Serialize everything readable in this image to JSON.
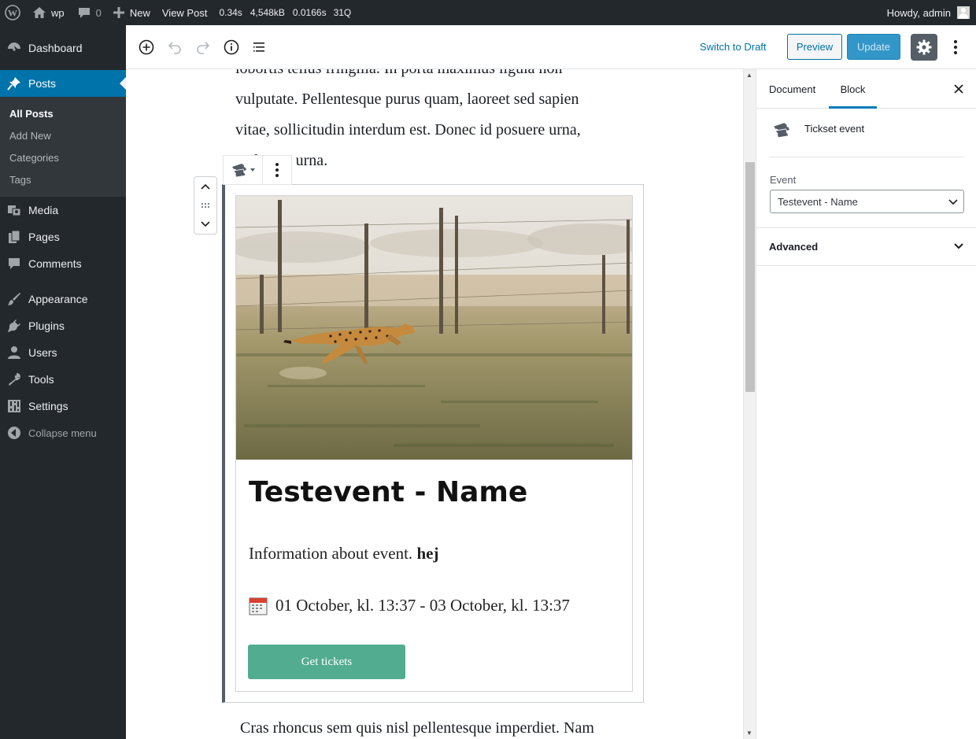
{
  "admin_bar": {
    "site_name": "wp",
    "comments_count": "0",
    "new_label": "New",
    "view_post_label": "View Post",
    "stats": [
      "0.34s",
      "4,548kB",
      "0.0166s",
      "31Q"
    ],
    "greeting": "Howdy, admin"
  },
  "menu": {
    "dashboard": "Dashboard",
    "posts": "Posts",
    "posts_submenu": [
      "All Posts",
      "Add New",
      "Categories",
      "Tags"
    ],
    "media": "Media",
    "pages": "Pages",
    "comments": "Comments",
    "appearance": "Appearance",
    "plugins": "Plugins",
    "users": "Users",
    "tools": "Tools",
    "settings": "Settings",
    "collapse": "Collapse menu"
  },
  "editor_header": {
    "switch_to_draft": "Switch to Draft",
    "preview": "Preview",
    "update": "Update"
  },
  "content": {
    "para_top": [
      "lobortis tellus fringilla. In porta maximus ligula non",
      "vulputate. Pellentesque purus quam, laoreet sed sapien",
      "vitae, sollicitudin interdum est. Donec id posuere urna,",
      "eu luctus urna."
    ],
    "para_bottom": "Cras rhoncus sem quis nisl pellentesque imperdiet. Nam"
  },
  "event_block": {
    "title": "Testevent - Name",
    "info": "Information about event.",
    "info_bold": "hej",
    "date": "01 October, kl. 13:37 - 03 October, kl. 13:37",
    "button": "Get tickets"
  },
  "settings_panel": {
    "tabs": [
      "Document",
      "Block"
    ],
    "active_tab": "Block",
    "block_name": "Tickset event",
    "event_label": "Event",
    "event_value": "Testevent - Name",
    "advanced_label": "Advanced"
  },
  "colors": {
    "admin_dark": "#23282d",
    "accent": "#0073aa",
    "ticket_button": "#52ac8f"
  }
}
